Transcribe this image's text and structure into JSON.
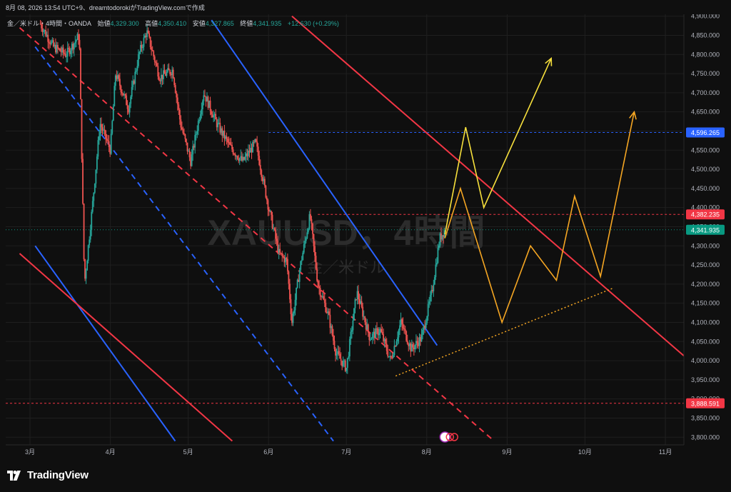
{
  "header": {
    "caption": "8月 08, 2026 13:54 UTC+9、dreamtodorokiがTradingView.comで作成"
  },
  "legend": {
    "symbol_desc": "金／米ドル・4時間・OANDA",
    "open_label": "始値",
    "open": "4,329.300",
    "high_label": "高値",
    "high": "4,350.410",
    "low_label": "安値",
    "low": "4,327.865",
    "close_label": "終値",
    "close": "4,341.935",
    "change": "+12.630 (+0.29%)"
  },
  "watermark": {
    "symbol": "XAUUSD，4時間",
    "desc": "金／米ドル"
  },
  "footer": {
    "brand": "TradingView"
  },
  "colors": {
    "background": "#0f0f0f",
    "up": "#26a69a",
    "down": "#ef5350",
    "channel_red": "#f23645",
    "channel_blue": "#2962ff",
    "scenario_yellow": "#f7e03c",
    "scenario_orange": "#f5a623"
  },
  "chart_data": {
    "type": "candlestick",
    "symbol": "XAUUSD",
    "timeframe": "4時間",
    "x_ticks": [
      "3月",
      "4月",
      "5月",
      "6月",
      "7月",
      "8月",
      "9月",
      "10月",
      "11月"
    ],
    "y_ticks": [
      "3,800.000",
      "3,850.000",
      "3,900.000",
      "3,950.000",
      "4,000.000",
      "4,050.000",
      "4,100.000",
      "4,150.000",
      "4,200.000",
      "4,250.000",
      "4,300.000",
      "4,350.000",
      "4,400.000",
      "4,450.000",
      "4,500.000",
      "4,550.000",
      "4,600.000",
      "4,650.000",
      "4,700.000",
      "4,750.000",
      "4,800.000",
      "4,850.000",
      "4,900.000"
    ],
    "ylim": [
      3780,
      4905
    ],
    "price_labels": [
      {
        "value": 4596.265,
        "text": "4,596.265",
        "color": "#2962ff",
        "line": "dashed-blue"
      },
      {
        "value": 4382.235,
        "text": "4,382.235",
        "color": "#f23645",
        "line": "dashed-red"
      },
      {
        "value": 4341.935,
        "text": "4,341.935",
        "color": "#089981",
        "line": "dotted-green"
      },
      {
        "value": 3888.591,
        "text": "3,888.591",
        "color": "#f23645",
        "line": "dashed-red"
      }
    ],
    "price_path": [
      [
        "3/5",
        4880
      ],
      [
        "3/10",
        4820
      ],
      [
        "3/15",
        4800
      ],
      [
        "3/20",
        4850
      ],
      [
        "3/22",
        4200
      ],
      [
        "3/25",
        4400
      ],
      [
        "3/28",
        4620
      ],
      [
        "4/1",
        4550
      ],
      [
        "4/3",
        4750
      ],
      [
        "4/8",
        4660
      ],
      [
        "4/12",
        4800
      ],
      [
        "4/15",
        4860
      ],
      [
        "4/20",
        4740
      ],
      [
        "4/25",
        4760
      ],
      [
        "4/28",
        4620
      ],
      [
        "5/2",
        4520
      ],
      [
        "5/7",
        4700
      ],
      [
        "5/12",
        4620
      ],
      [
        "5/17",
        4560
      ],
      [
        "5/22",
        4520
      ],
      [
        "5/27",
        4570
      ],
      [
        "6/1",
        4400
      ],
      [
        "6/5",
        4280
      ],
      [
        "6/8",
        4260
      ],
      [
        "6/10",
        4100
      ],
      [
        "6/13",
        4240
      ],
      [
        "6/17",
        4380
      ],
      [
        "6/20",
        4200
      ],
      [
        "6/24",
        4120
      ],
      [
        "6/27",
        4020
      ],
      [
        "7/1",
        3980
      ],
      [
        "7/5",
        4180
      ],
      [
        "7/10",
        4060
      ],
      [
        "7/14",
        4080
      ],
      [
        "7/18",
        4000
      ],
      [
        "7/22",
        4100
      ],
      [
        "7/26",
        4030
      ],
      [
        "7/30",
        4060
      ],
      [
        "8/3",
        4180
      ],
      [
        "8/6",
        4320
      ],
      [
        "8/8",
        4342
      ]
    ],
    "scenarios": {
      "yellow": [
        [
          "8/8",
          4330
        ],
        [
          "8/16",
          4610
        ],
        [
          "8/23",
          4400
        ],
        [
          "9/18",
          4790
        ]
      ],
      "orange": [
        [
          "8/8",
          4320
        ],
        [
          "8/14",
          4450
        ],
        [
          "8/30",
          4100
        ],
        [
          "9/10",
          4300
        ],
        [
          "9/20",
          4210
        ],
        [
          "9/27",
          4430
        ],
        [
          "10/7",
          4220
        ],
        [
          "10/20",
          4650
        ]
      ]
    },
    "support_line": [
      [
        "7/20",
        3960
      ],
      [
        "10/12",
        4190
      ]
    ],
    "channels": {
      "blue_solid_upper": [
        [
          "5/10",
          4890
        ],
        [
          "8/5",
          4040
        ]
      ],
      "blue_solid_lower": [
        [
          "3/3",
          4300
        ],
        [
          "4/26",
          3790
        ]
      ],
      "blue_dashed": [
        [
          "3/3",
          4820
        ],
        [
          "6/26",
          3790
        ]
      ],
      "red_solid_upper": [
        [
          "6/10",
          4900
        ],
        [
          "11/12",
          3990
        ]
      ],
      "red_solid_lower": [
        [
          "2/25",
          4280
        ],
        [
          "5/18",
          3790
        ]
      ],
      "red_dashed": [
        [
          "2/25",
          4870
        ],
        [
          "8/27",
          3790
        ]
      ]
    }
  }
}
